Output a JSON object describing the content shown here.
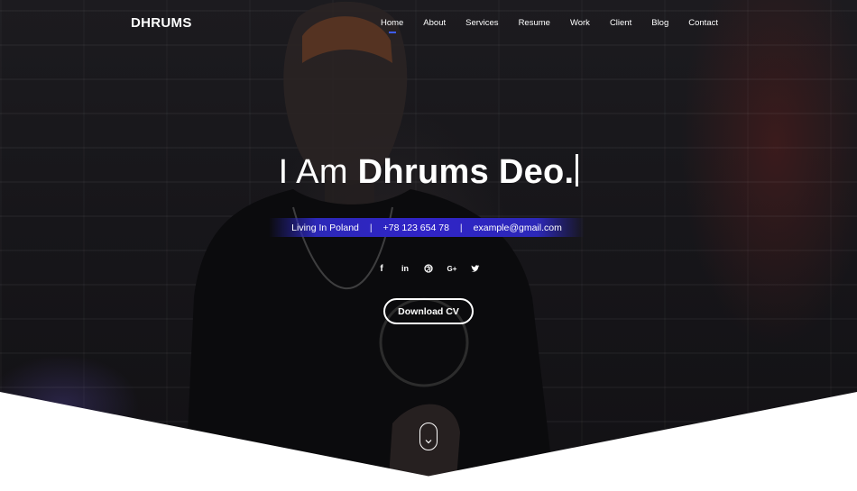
{
  "brand": {
    "logo_text": "DHRUMS"
  },
  "nav": {
    "items": [
      {
        "label": "Home",
        "active": true
      },
      {
        "label": "About"
      },
      {
        "label": "Services"
      },
      {
        "label": "Resume"
      },
      {
        "label": "Work"
      },
      {
        "label": "Client"
      },
      {
        "label": "Blog"
      },
      {
        "label": "Contact"
      }
    ],
    "active_underline_color": "#3d5cff"
  },
  "hero": {
    "headline_prefix": "I Am ",
    "headline_name": "Dhrums Deo.",
    "info": {
      "location": "Living In Poland",
      "phone": "+78 123 654 78",
      "email": "example@gmail.com",
      "separator": "|",
      "bar_color": "#3024c8"
    },
    "socials": [
      "facebook-icon",
      "linkedin-icon",
      "dribbble-icon",
      "google-plus-icon",
      "twitter-icon"
    ],
    "social_glyphs": {
      "facebook": "f",
      "linkedin": "in",
      "google_plus": "G+"
    },
    "cta_label": "Download CV"
  }
}
